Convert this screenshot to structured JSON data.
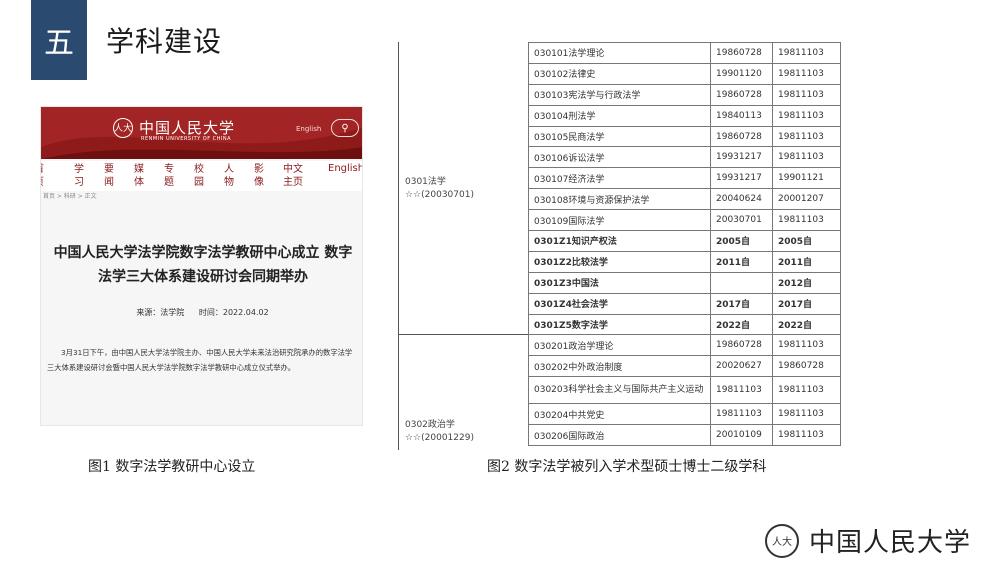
{
  "section": {
    "number": "五",
    "title": "学科建设"
  },
  "news": {
    "logo_cn": "中国人民大学",
    "logo_en": "RENMIN UNIVERSITY OF CHINA",
    "lang": "English",
    "nav": [
      {
        "l1": "首",
        "l2": "页"
      },
      {
        "l1": "学",
        "l2": "习"
      },
      {
        "l1": "要",
        "l2": "闻"
      },
      {
        "l1": "媒",
        "l2": "体"
      },
      {
        "l1": "专",
        "l2": "题"
      },
      {
        "l1": "校",
        "l2": "园"
      },
      {
        "l1": "人",
        "l2": "物"
      },
      {
        "l1": "影",
        "l2": "像"
      },
      {
        "l1": "中文",
        "l2": "主页"
      }
    ],
    "nav_en": "English",
    "breadcrumb": "首页 > 科研 > 正文",
    "title": "中国人民大学法学院数字法学教研中心成立 数字法学三大体系建设研讨会同期举办",
    "source": "来源：法学院",
    "time": "时间：2022.04.02",
    "body": "3月31日下午，由中国人民大学法学院主办、中国人民大学未来法治研究院承办的数字法学三大体系建设研讨会暨中国人民大学法学院数字法学教研中心成立仪式举办。"
  },
  "captions": {
    "fig1": "图1  数字法学教研中心设立",
    "fig2": "图2  数字法学被列入学术型硕士博士二级学科"
  },
  "disciplines": {
    "groups": [
      {
        "code": "0301法学",
        "stars": "☆☆(20030701)"
      },
      {
        "code": "0302政治学",
        "stars": "☆☆(20001229)"
      }
    ],
    "rows": [
      {
        "name": "030101法学理论",
        "d1": "19860728",
        "d2": "19811103",
        "bold": false
      },
      {
        "name": "030102法律史",
        "d1": "19901120",
        "d2": "19811103",
        "bold": false
      },
      {
        "name": "030103宪法学与行政法学",
        "d1": "19860728",
        "d2": "19811103",
        "bold": false
      },
      {
        "name": "030104刑法学",
        "d1": "19840113",
        "d2": "19811103",
        "bold": false
      },
      {
        "name": "030105民商法学",
        "d1": "19860728",
        "d2": "19811103",
        "bold": false
      },
      {
        "name": "030106诉讼法学",
        "d1": "19931217",
        "d2": "19811103",
        "bold": false
      },
      {
        "name": "030107经济法学",
        "d1": "19931217",
        "d2": "19901121",
        "bold": false
      },
      {
        "name": "030108环境与资源保护法学",
        "d1": "20040624",
        "d2": "20001207",
        "bold": false
      },
      {
        "name": "030109国际法学",
        "d1": "20030701",
        "d2": "19811103",
        "bold": false
      },
      {
        "name": "0301Z1知识产权法",
        "d1": "2005自",
        "d2": "2005自",
        "bold": true
      },
      {
        "name": "0301Z2比较法学",
        "d1": "2011自",
        "d2": "2011自",
        "bold": true
      },
      {
        "name": "0301Z3中国法",
        "d1": "",
        "d2": "2012自",
        "bold": true
      },
      {
        "name": "0301Z4社会法学",
        "d1": "2017自",
        "d2": "2017自",
        "bold": true
      },
      {
        "name": "0301Z5数字法学",
        "d1": "2022自",
        "d2": "2022自",
        "bold": true
      },
      {
        "name": "030201政治学理论",
        "d1": "19860728",
        "d2": "19811103",
        "bold": false
      },
      {
        "name": "030202中外政治制度",
        "d1": "20020627",
        "d2": "19860728",
        "bold": false
      },
      {
        "name": "030203科学社会主义与国际共产主义运动",
        "d1": "19811103",
        "d2": "19811103",
        "bold": false
      },
      {
        "name": "030204中共党史",
        "d1": "19811103",
        "d2": "19811103",
        "bold": false
      },
      {
        "name": "030206国际政治",
        "d1": "20010109",
        "d2": "19811103",
        "bold": false
      }
    ]
  },
  "footer": {
    "logo_cn": "中国人民大学"
  }
}
